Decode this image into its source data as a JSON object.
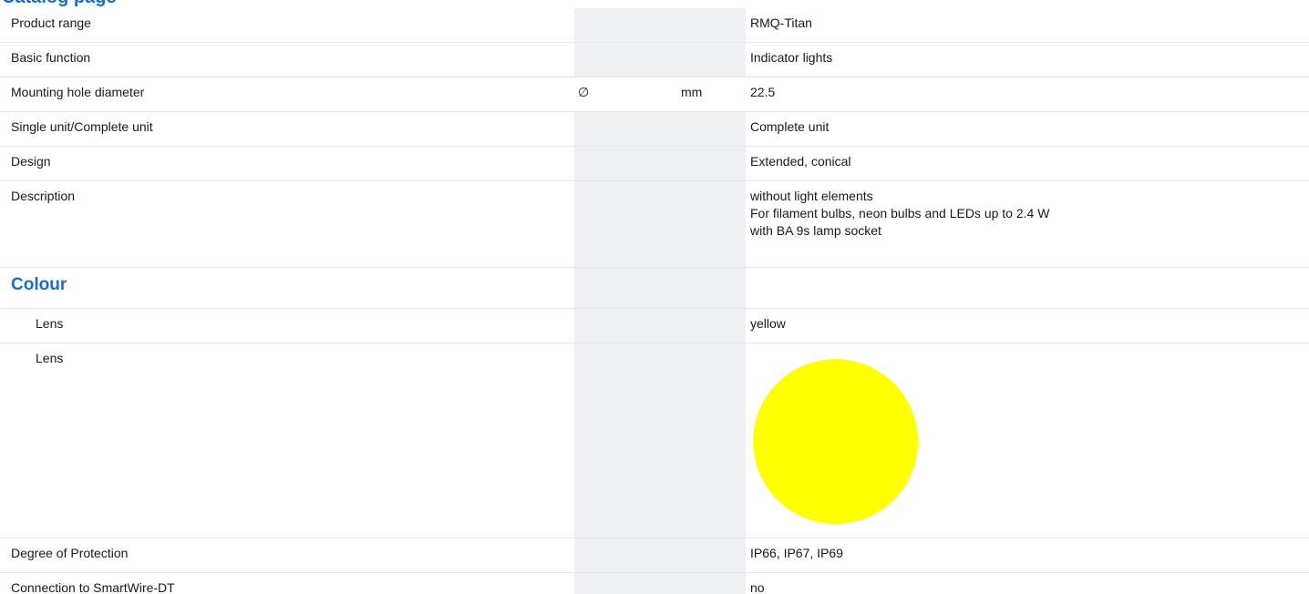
{
  "page": {
    "top_heading": "Catalog page"
  },
  "rows": {
    "product_range": {
      "label": "Product range",
      "value": "RMQ-Titan"
    },
    "basic_function": {
      "label": "Basic function",
      "value": "Indicator lights"
    },
    "mounting_hole": {
      "label": "Mounting hole diameter",
      "symbol": "∅",
      "unit": "mm",
      "value": "22.5"
    },
    "single_complete": {
      "label": "Single unit/Complete unit",
      "value": "Complete unit"
    },
    "design": {
      "label": "Design",
      "value": "Extended, conical"
    },
    "description": {
      "label": "Description",
      "lines": [
        "without light elements",
        "For filament bulbs, neon bulbs and LEDs up to 2.4 W",
        "with BA 9s lamp socket"
      ]
    },
    "colour_section": {
      "title": "Colour"
    },
    "lens_text": {
      "label": "Lens",
      "value": "yellow"
    },
    "lens_image": {
      "label": "Lens",
      "swatch_color": "#ffff00"
    },
    "protection": {
      "label": "Degree of Protection",
      "value": "IP66, IP67, IP69"
    },
    "smartwire": {
      "label": "Connection to SmartWire-DT",
      "value": "no"
    }
  },
  "colors": {
    "accent": "#1a6fc4",
    "column_shade": "#eef0f3",
    "row_divider": "#e5e7ea"
  }
}
